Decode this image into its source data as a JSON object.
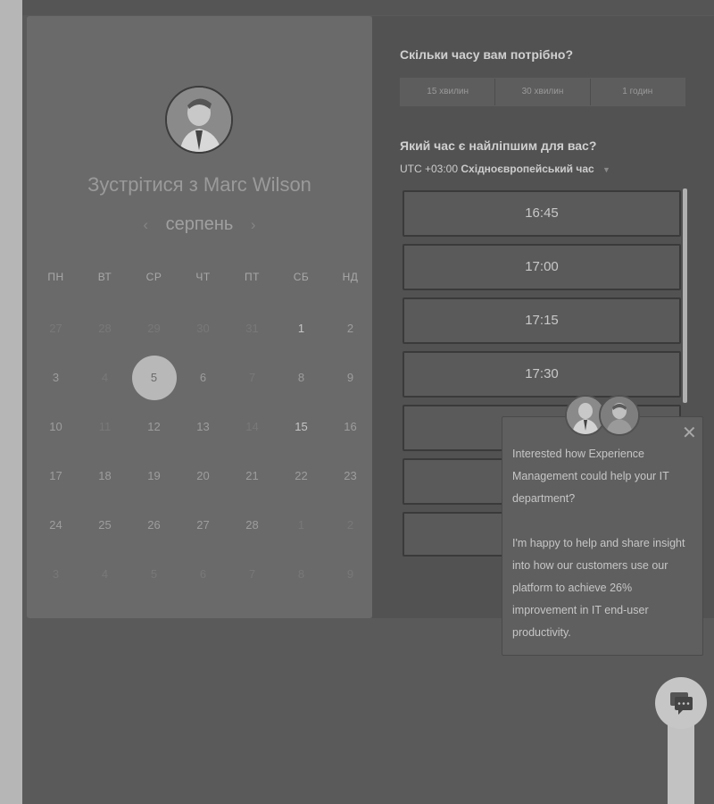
{
  "calendar": {
    "title": "Зустрітися з Marc Wilson",
    "month": "серпень",
    "weekdays": [
      "ПН",
      "ВТ",
      "СР",
      "ЧТ",
      "ПТ",
      "СБ",
      "НД"
    ],
    "weeks": [
      [
        "27",
        "28",
        "29",
        "30",
        "31",
        "1",
        "2"
      ],
      [
        "3",
        "4",
        "5",
        "6",
        "7",
        "8",
        "9"
      ],
      [
        "10",
        "11",
        "12",
        "13",
        "14",
        "15",
        "16"
      ],
      [
        "17",
        "18",
        "19",
        "20",
        "21",
        "22",
        "23"
      ],
      [
        "24",
        "25",
        "26",
        "27",
        "28",
        "1",
        "2"
      ],
      [
        "3",
        "4",
        "5",
        "6",
        "7",
        "8",
        "9"
      ]
    ],
    "selected_day": "5"
  },
  "duration": {
    "heading": "Скільки часу вам потрібно?",
    "options": [
      "15 хвилин",
      "30 хвилин",
      "1 годин"
    ]
  },
  "timeslots": {
    "heading": "Який час є найліпшим для вас?",
    "tz_prefix": "UTC +03:00",
    "tz_name": "Східноєвропейський час",
    "slots": [
      "16:45",
      "17:00",
      "17:15",
      "17:30",
      "",
      "",
      ""
    ]
  },
  "chat": {
    "paragraph1": "Interested how Experience Management could help your IT department?",
    "paragraph2": "I'm happy to help and share insight into how our customers use our platform to achieve 26% improvement in IT end-user productivity."
  }
}
